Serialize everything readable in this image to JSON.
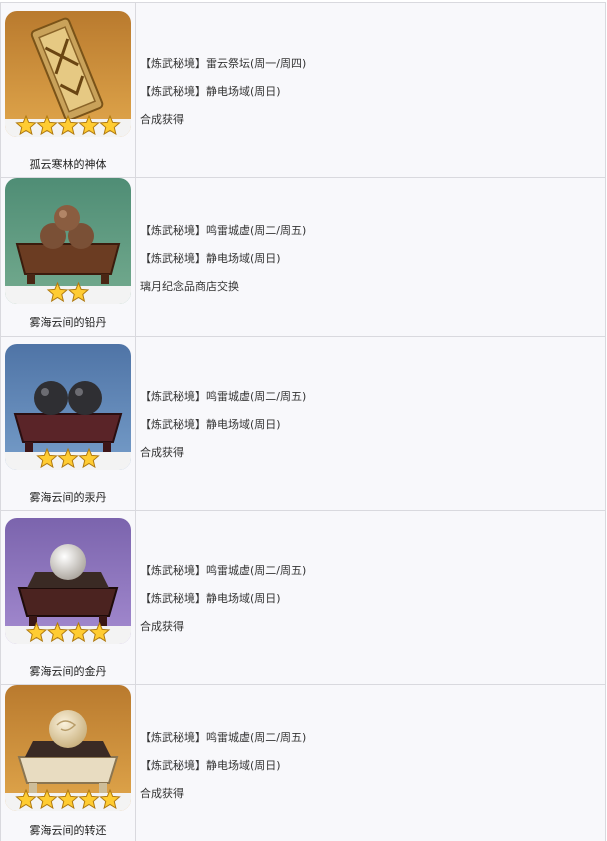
{
  "items": [
    {
      "name": "孤云寒林的神体",
      "stars": 5,
      "bg": "#d69a3c",
      "sources": [
        "【炼武秘境】雷云祭坛(周一/周四)",
        "【炼武秘境】静电场域(周日)",
        "合成获得"
      ]
    },
    {
      "name": "雾海云间的铅丹",
      "stars": 2,
      "bg": "#5f9a7f",
      "sources": [
        "【炼武秘境】鸣雷城虚(周二/周五)",
        "【炼武秘境】静电场域(周日)",
        "璃月纪念品商店交换"
      ]
    },
    {
      "name": "雾海云间的汞丹",
      "stars": 3,
      "bg": "#5f87b6",
      "sources": [
        "【炼武秘境】鸣雷城虚(周二/周五)",
        "【炼武秘境】静电场域(周日)",
        "合成获得"
      ]
    },
    {
      "name": "雾海云间的金丹",
      "stars": 4,
      "bg": "#8c74bd",
      "sources": [
        "【炼武秘境】鸣雷城虚(周二/周五)",
        "【炼武秘境】静电场域(周日)",
        "合成获得"
      ]
    },
    {
      "name": "雾海云间的转还",
      "stars": 5,
      "bg": "#d69a3c",
      "sources": [
        "【炼武秘境】鸣雷城虚(周二/周五)",
        "【炼武秘境】静电场域(周日)",
        "合成获得"
      ]
    }
  ]
}
